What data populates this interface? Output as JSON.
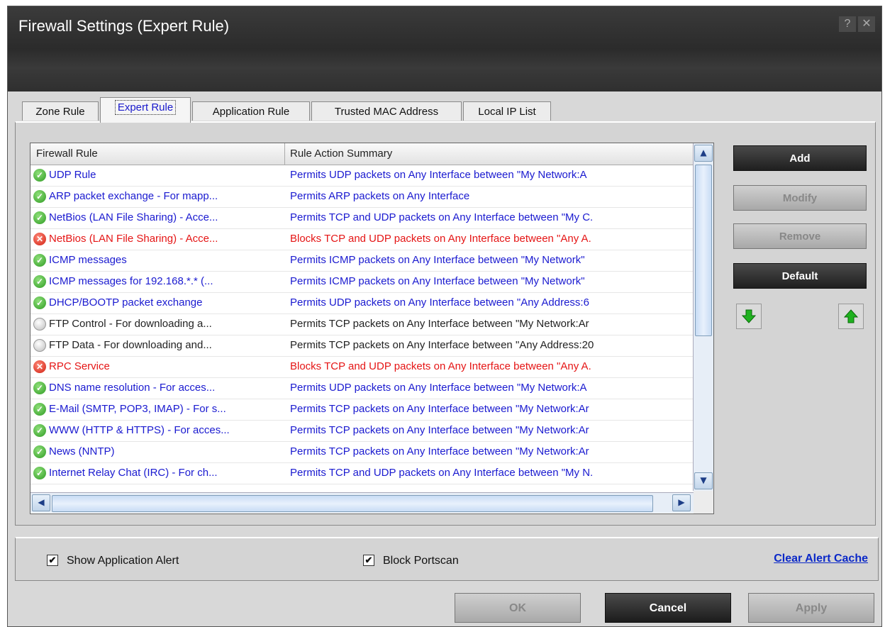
{
  "window": {
    "title": "Firewall Settings (Expert Rule)",
    "help_glyph": "?",
    "close_glyph": "✕"
  },
  "tabs": [
    {
      "label": "Zone Rule",
      "active": false
    },
    {
      "label": "Expert Rule",
      "active": true
    },
    {
      "label": "Application Rule",
      "active": false
    },
    {
      "label": "Trusted MAC Address",
      "active": false
    },
    {
      "label": "Local IP List",
      "active": false
    }
  ],
  "table": {
    "columns": [
      "Firewall Rule",
      "Rule Action Summary"
    ],
    "rows": [
      {
        "status": "allow",
        "rule": "UDP Rule",
        "summary": "Permits UDP packets on Any Interface between \"My Network:A"
      },
      {
        "status": "allow",
        "rule": "ARP packet exchange - For mapp...",
        "summary": "Permits ARP packets on Any Interface"
      },
      {
        "status": "allow",
        "rule": "NetBios (LAN File Sharing) - Acce...",
        "summary": "Permits TCP and UDP packets on Any Interface between \"My C."
      },
      {
        "status": "block",
        "rule": "NetBios (LAN File Sharing) - Acce...",
        "summary": "Blocks TCP and UDP packets on Any Interface between \"Any A."
      },
      {
        "status": "allow",
        "rule": "ICMP messages",
        "summary": "Permits ICMP packets on Any Interface between \"My Network\""
      },
      {
        "status": "allow",
        "rule": "ICMP messages for  192.168.*.* (...",
        "summary": "Permits ICMP packets on Any Interface between \"My Network\""
      },
      {
        "status": "allow",
        "rule": "DHCP/BOOTP packet exchange",
        "summary": "Permits UDP packets on Any Interface between \"Any Address:6"
      },
      {
        "status": "neutral",
        "rule": "FTP Control - For downloading a...",
        "summary": "Permits TCP packets on Any Interface between \"My Network:Ar"
      },
      {
        "status": "neutral",
        "rule": "FTP Data - For downloading and...",
        "summary": "Permits TCP packets on Any Interface between \"Any Address:20"
      },
      {
        "status": "block",
        "rule": "RPC Service",
        "summary": "Blocks TCP and UDP packets on Any Interface between \"Any A."
      },
      {
        "status": "allow",
        "rule": "DNS name resolution - For acces...",
        "summary": "Permits UDP packets on Any Interface between \"My Network:A"
      },
      {
        "status": "allow",
        "rule": "E-Mail (SMTP, POP3, IMAP) - For s...",
        "summary": "Permits TCP packets on Any Interface between \"My Network:Ar"
      },
      {
        "status": "allow",
        "rule": "WWW (HTTP & HTTPS) - For acces...",
        "summary": "Permits TCP packets on Any Interface between \"My Network:Ar"
      },
      {
        "status": "allow",
        "rule": "News (NNTP)",
        "summary": "Permits TCP packets on Any Interface between \"My Network:Ar"
      },
      {
        "status": "allow",
        "rule": "Internet Relay Chat (IRC) - For ch...",
        "summary": "Permits TCP and UDP packets on Any Interface between \"My N."
      }
    ]
  },
  "side_buttons": {
    "add": "Add",
    "modify": "Modify",
    "remove": "Remove",
    "default": "Default"
  },
  "icons": {
    "move_down": "green-down-arrow-icon",
    "move_up": "green-up-arrow-icon"
  },
  "options": {
    "show_app_alert": {
      "label": "Show Application Alert",
      "checked": true
    },
    "block_portscan": {
      "label": "Block Portscan",
      "checked": true
    },
    "clear_cache_link": "Clear Alert Cache"
  },
  "footer": {
    "ok": "OK",
    "cancel": "Cancel",
    "apply": "Apply"
  },
  "colors": {
    "allow_text": "#1a1ad0",
    "block_text": "#e51515",
    "titlebar": "#2e2e2e",
    "link": "#0a28c8"
  }
}
